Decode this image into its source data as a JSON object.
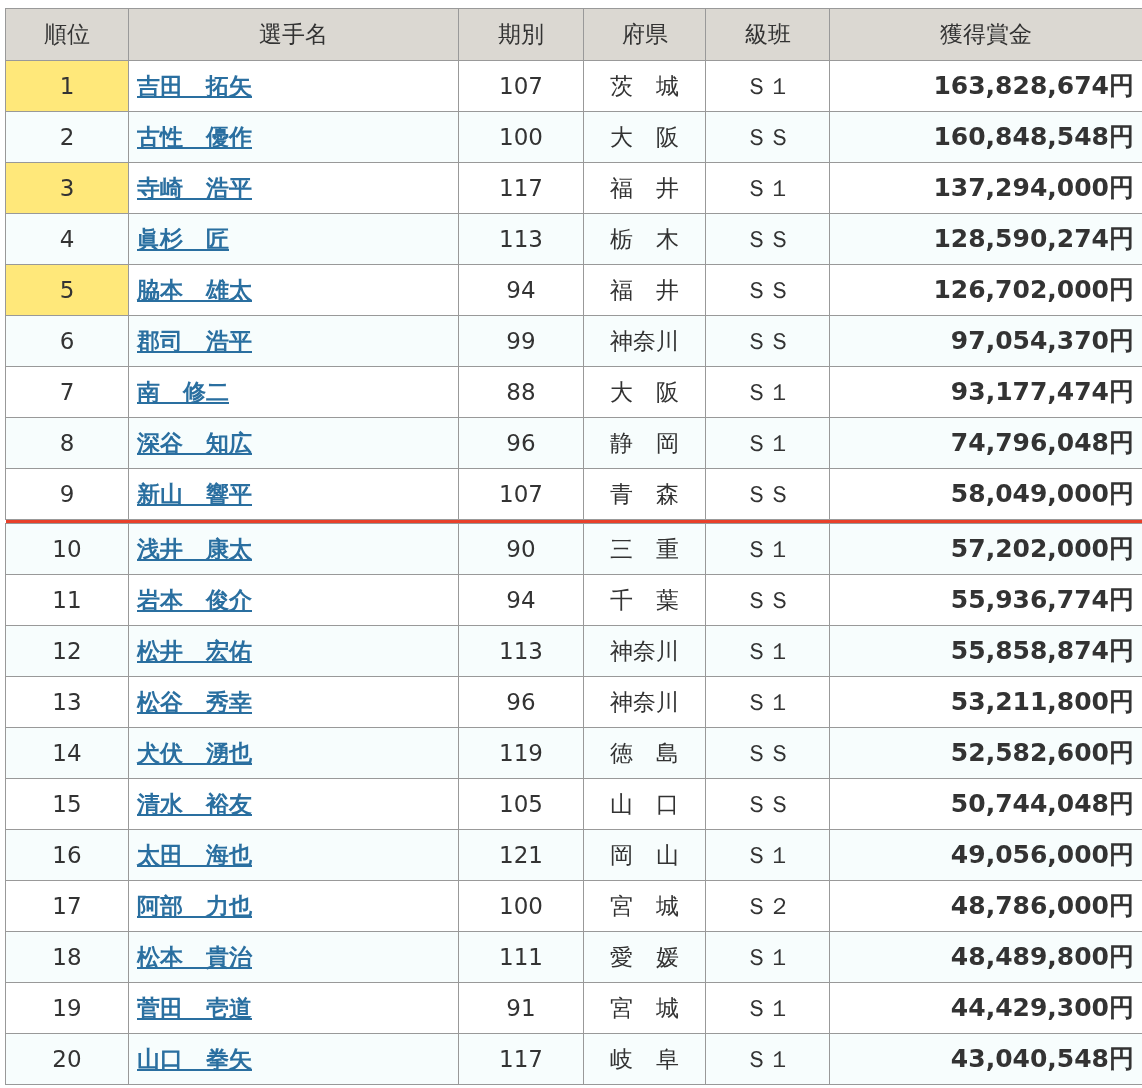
{
  "table": {
    "columns": [
      "順位",
      "選手名",
      "期別",
      "府県",
      "級班",
      "獲得賞金"
    ],
    "rows": [
      {
        "rank": "1",
        "name": "吉田　拓矢",
        "term": "107",
        "pref": "茨　城",
        "class": "Ｓ１",
        "prize": "163,828,674円",
        "highlighted": true,
        "cutoff_after": false
      },
      {
        "rank": "2",
        "name": "古性　優作",
        "term": "100",
        "pref": "大　阪",
        "class": "ＳＳ",
        "prize": "160,848,548円",
        "highlighted": false,
        "cutoff_after": false
      },
      {
        "rank": "3",
        "name": "寺崎　浩平",
        "term": "117",
        "pref": "福　井",
        "class": "Ｓ１",
        "prize": "137,294,000円",
        "highlighted": true,
        "cutoff_after": false
      },
      {
        "rank": "4",
        "name": "眞杉　匠",
        "term": "113",
        "pref": "栃　木",
        "class": "ＳＳ",
        "prize": "128,590,274円",
        "highlighted": false,
        "cutoff_after": false
      },
      {
        "rank": "5",
        "name": "脇本　雄太",
        "term": "94",
        "pref": "福　井",
        "class": "ＳＳ",
        "prize": "126,702,000円",
        "highlighted": true,
        "cutoff_after": false
      },
      {
        "rank": "6",
        "name": "郡司　浩平",
        "term": "99",
        "pref": "神奈川",
        "class": "ＳＳ",
        "prize": "97,054,370円",
        "highlighted": false,
        "cutoff_after": false
      },
      {
        "rank": "7",
        "name": "南　修二",
        "term": "88",
        "pref": "大　阪",
        "class": "Ｓ１",
        "prize": "93,177,474円",
        "highlighted": false,
        "cutoff_after": false
      },
      {
        "rank": "8",
        "name": "深谷　知広",
        "term": "96",
        "pref": "静　岡",
        "class": "Ｓ１",
        "prize": "74,796,048円",
        "highlighted": false,
        "cutoff_after": false
      },
      {
        "rank": "9",
        "name": "新山　響平",
        "term": "107",
        "pref": "青　森",
        "class": "ＳＳ",
        "prize": "58,049,000円",
        "highlighted": false,
        "cutoff_after": true
      },
      {
        "rank": "10",
        "name": "浅井　康太",
        "term": "90",
        "pref": "三　重",
        "class": "Ｓ１",
        "prize": "57,202,000円",
        "highlighted": false,
        "cutoff_after": false
      },
      {
        "rank": "11",
        "name": "岩本　俊介",
        "term": "94",
        "pref": "千　葉",
        "class": "ＳＳ",
        "prize": "55,936,774円",
        "highlighted": false,
        "cutoff_after": false
      },
      {
        "rank": "12",
        "name": "松井　宏佑",
        "term": "113",
        "pref": "神奈川",
        "class": "Ｓ１",
        "prize": "55,858,874円",
        "highlighted": false,
        "cutoff_after": false
      },
      {
        "rank": "13",
        "name": "松谷　秀幸",
        "term": "96",
        "pref": "神奈川",
        "class": "Ｓ１",
        "prize": "53,211,800円",
        "highlighted": false,
        "cutoff_after": false
      },
      {
        "rank": "14",
        "name": "犬伏　湧也",
        "term": "119",
        "pref": "徳　島",
        "class": "ＳＳ",
        "prize": "52,582,600円",
        "highlighted": false,
        "cutoff_after": false
      },
      {
        "rank": "15",
        "name": "清水　裕友",
        "term": "105",
        "pref": "山　口",
        "class": "ＳＳ",
        "prize": "50,744,048円",
        "highlighted": false,
        "cutoff_after": false
      },
      {
        "rank": "16",
        "name": "太田　海也",
        "term": "121",
        "pref": "岡　山",
        "class": "Ｓ１",
        "prize": "49,056,000円",
        "highlighted": false,
        "cutoff_after": false
      },
      {
        "rank": "17",
        "name": "阿部　力也",
        "term": "100",
        "pref": "宮　城",
        "class": "Ｓ２",
        "prize": "48,786,000円",
        "highlighted": false,
        "cutoff_after": false
      },
      {
        "rank": "18",
        "name": "松本　貴治",
        "term": "111",
        "pref": "愛　媛",
        "class": "Ｓ１",
        "prize": "48,489,800円",
        "highlighted": false,
        "cutoff_after": false
      },
      {
        "rank": "19",
        "name": "菅田　壱道",
        "term": "91",
        "pref": "宮　城",
        "class": "Ｓ１",
        "prize": "44,429,300円",
        "highlighted": false,
        "cutoff_after": false
      },
      {
        "rank": "20",
        "name": "山口　拳矢",
        "term": "117",
        "pref": "岐　阜",
        "class": "Ｓ１",
        "prize": "43,040,548円",
        "highlighted": false,
        "cutoff_after": false
      }
    ]
  }
}
